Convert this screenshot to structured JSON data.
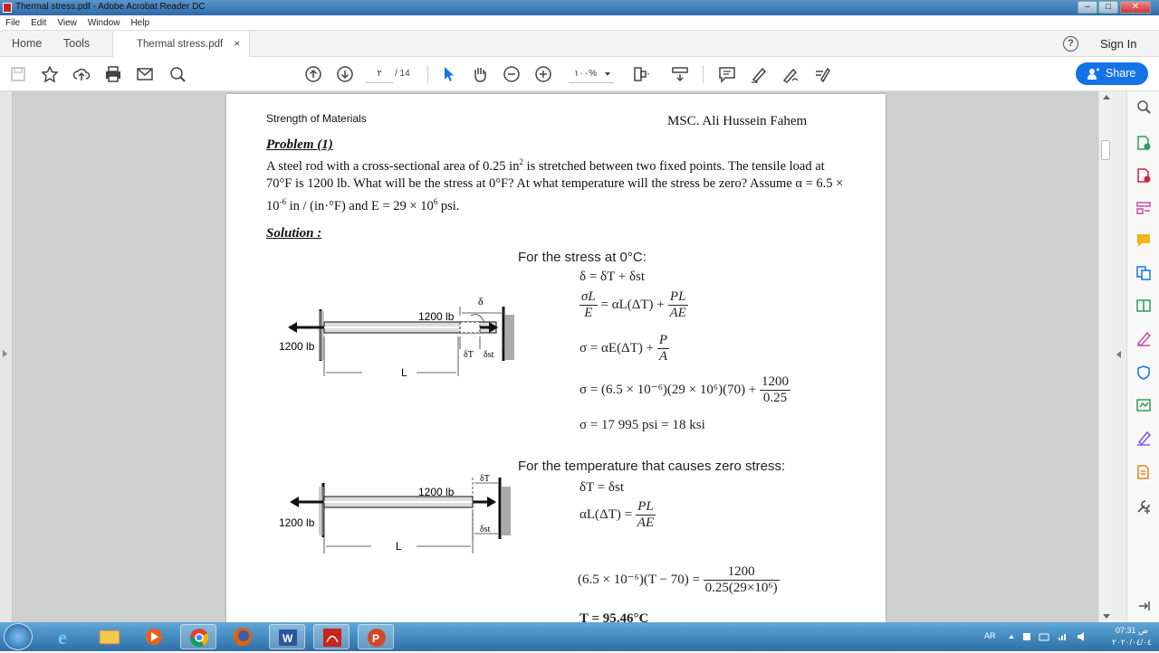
{
  "window": {
    "title": "Thermal stress.pdf - Adobe Acrobat Reader DC",
    "controls": [
      "–",
      "□",
      "✕"
    ]
  },
  "menu": [
    "File",
    "Edit",
    "View",
    "Window",
    "Help"
  ],
  "tabs": {
    "home": "Home",
    "tools": "Tools",
    "document": "Thermal stress.pdf",
    "close": "×"
  },
  "header": {
    "help": "?",
    "sign_in": "Sign In"
  },
  "toolbar": {
    "current_page": "٢",
    "page_count": "/ 14",
    "zoom": "١٠٠%",
    "share": "Share"
  },
  "document": {
    "header_left": "Strength of Materials",
    "header_right": "MSC. Ali Hussein Fahem",
    "problem_title": "Problem (1)",
    "problem_text_1": "A steel rod with a cross-sectional area of 0.25 in",
    "sup_2": "2",
    "problem_text_2": " is stretched between two fixed points. The tensile load at 70°F is 1200 lb. What will be the stress at 0°F? At what temperature will the stress be zero? Assume α = 6.5 × 10",
    "sup_neg6": "-6",
    "problem_text_3": " in / (in·°F) and E = 29 × 10",
    "sup_6": "6",
    "problem_text_4": " psi.",
    "solution_title": "Solution :",
    "part1_heading": "For the stress at 0°C:",
    "part2_heading": "For the temperature that causes zero stress:",
    "eq1": "δ = δT + δst",
    "eq_sigma_alpha": "σ = αE(ΔT) +",
    "eq_num_sub": "σ = (6.5 × 10⁻⁶)(29 × 10⁶)(70) +",
    "eq_result": "σ = 17 995 psi = 18 ksi",
    "eq_zero": "δT = δst",
    "eq_T_left": "(6.5 × 10⁻⁶)(T − 70) =",
    "eq_T_result": "T = 95.46°C",
    "frac_PA": {
      "n": "P",
      "d": "A"
    },
    "frac_1200": {
      "n": "1200",
      "d": "0.25"
    },
    "frac_T": {
      "n": "1200",
      "d": "0.25(29×10⁶)"
    },
    "frac_sigmaL": {
      "n": "σL",
      "d": "E"
    },
    "frac_PL": {
      "n": "PL",
      "d": "AE"
    },
    "eq_alphaL": "= αL(ΔT) +",
    "eq_alphaL2": "αL(ΔT) =",
    "diagram_labels": {
      "load": "1200 lb",
      "delta": "δ",
      "length": "L",
      "deltaT": "δT",
      "deltaSt": "δst"
    }
  },
  "tray": {
    "lang": "AR",
    "time": "07:31 ص",
    "date": "٢٠٢٠/٠٤/٠٤"
  }
}
